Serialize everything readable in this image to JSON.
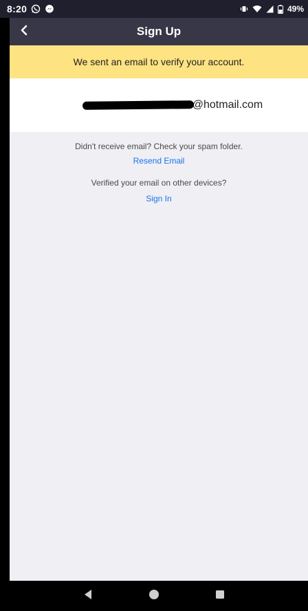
{
  "status_bar": {
    "time": "8:20",
    "battery": "49%"
  },
  "header": {
    "title": "Sign Up"
  },
  "notice": {
    "text": "We sent an email to verify your account."
  },
  "email": {
    "domain": "@hotmail.com"
  },
  "help": {
    "spam_text": "Didn't receive email? Check your spam folder.",
    "resend_link": "Resend Email",
    "other_devices_text": "Verified your email on other devices?",
    "sign_in_link": "Sign In"
  },
  "colors": {
    "header_bg": "#373747",
    "banner_bg": "#fde382",
    "link": "#1a73e8",
    "page_bg": "#efeff4"
  },
  "icons": {
    "status_left": [
      "whatsapp-icon",
      "messenger-icon"
    ],
    "status_right": [
      "vibrate-icon",
      "wifi-icon",
      "signal-icon",
      "battery-icon"
    ],
    "nav": [
      "back-triangle-icon",
      "home-circle-icon",
      "recents-square-icon"
    ]
  }
}
